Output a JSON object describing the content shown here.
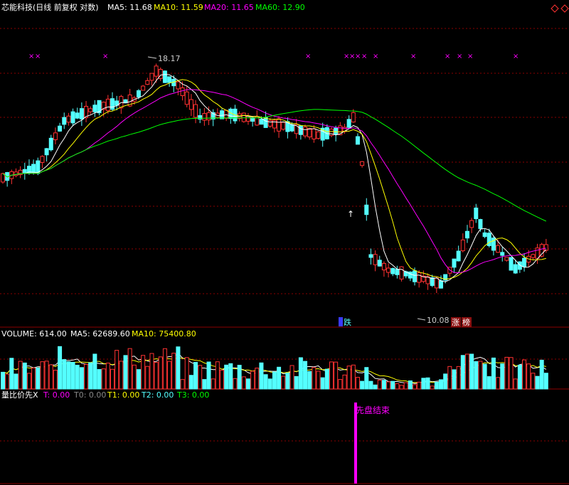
{
  "main_header": {
    "title": "芯能科技(日线 前复权 对数)",
    "ma5": "MA5: 11.68",
    "ma10": "MA10: 11.59",
    "ma20": "MA20: 11.65",
    "ma60": "MA60: 12.90"
  },
  "volume_header": {
    "title": "VOLUME: 614.00",
    "ma5": "MA5: 62689.60",
    "ma10": "MA10: 75400.80"
  },
  "indicator_header": {
    "title": "量比价先X",
    "t": "T: 0.00",
    "t0": "T0: 0.00",
    "t1": "T1: 0.00",
    "t2": "T2: 0.00",
    "t3": "T3: 0.00"
  },
  "annotations": {
    "high": "18.17",
    "low": "10.08",
    "fall": "跌",
    "rise": "涨",
    "board": "榜",
    "bar_label": "先盘结束",
    "marker": "×",
    "up_arrow": "↑"
  },
  "colors": {
    "up": "#ff3232",
    "down": "#54ffff",
    "ma5": "#ffffff",
    "ma10": "#ffff00",
    "ma20": "#ff00ff",
    "ma60": "#00ff00",
    "grid": "#8b0000",
    "marker": "#ff00ff"
  },
  "chart_data": {
    "type": "candlestick",
    "scale": "log",
    "price_high_marker": 18.17,
    "price_low_marker": 10.08,
    "ma_last": {
      "MA5": 11.68,
      "MA10": 11.59,
      "MA20": 11.65,
      "MA60": 12.9
    },
    "volume_last": 614.0,
    "volume_ma_last": {
      "MA5": 62689.6,
      "MA10": 75400.8
    },
    "indicator_last": {
      "T": 0.0,
      "T0": 0.0,
      "T1": 0.0,
      "T2": 0.0,
      "T3": 0.0
    }
  }
}
